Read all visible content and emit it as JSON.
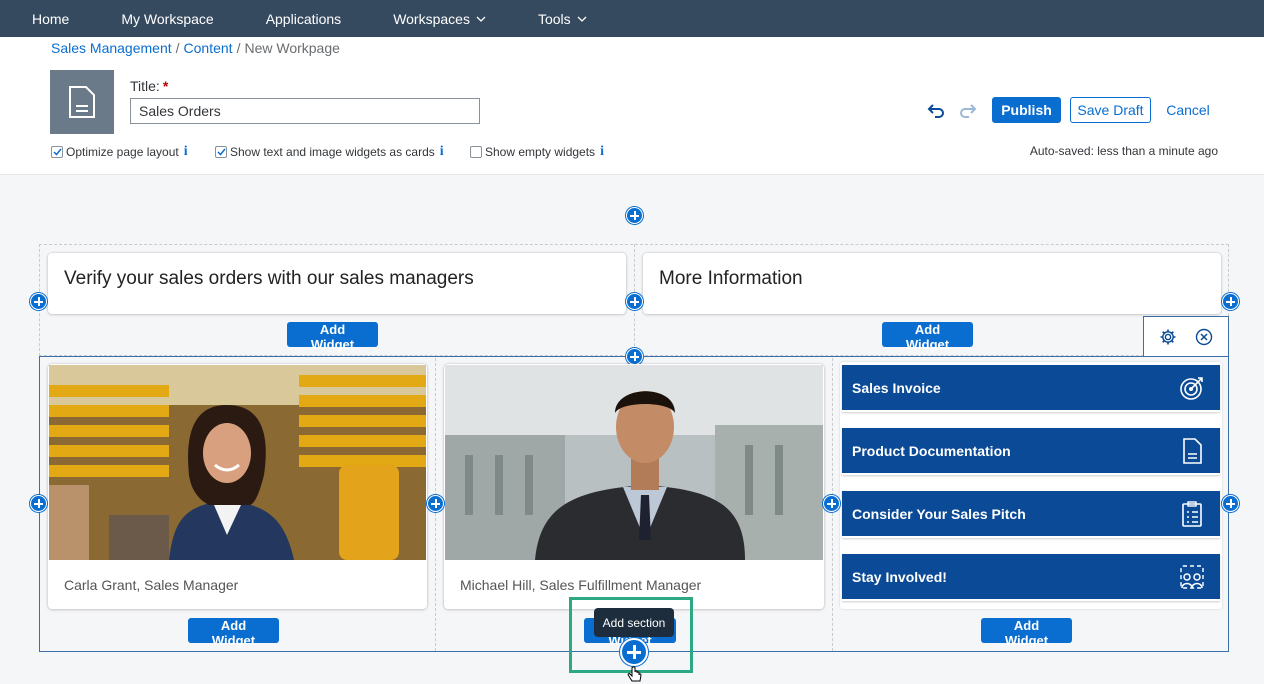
{
  "topnav": {
    "items": [
      {
        "label": "Home"
      },
      {
        "label": "My Workspace"
      },
      {
        "label": "Applications"
      },
      {
        "label": "Workspaces"
      },
      {
        "label": "Tools"
      }
    ]
  },
  "breadcrumb": {
    "items": [
      "Sales Management",
      "Content"
    ],
    "current": "New Workpage"
  },
  "header": {
    "page_icon": "document-icon",
    "title_label": "Title:",
    "required_marker": "*",
    "title_value": "Sales Orders",
    "publish_label": "Publish",
    "save_draft_label": "Save Draft",
    "cancel_label": "Cancel",
    "autosave_text": "Auto-saved: less than a minute ago"
  },
  "options": [
    {
      "label": "Optimize page layout",
      "checked": true
    },
    {
      "label": "Show text and image widgets as cards",
      "checked": true
    },
    {
      "label": "Show empty widgets",
      "checked": false
    }
  ],
  "info_glyph": "i",
  "section1": {
    "left_text": "Verify your sales orders with our sales managers",
    "right_text": "More Information",
    "add_widget_label": "Add Widget"
  },
  "section2": {
    "person1": "Carla Grant, Sales Manager",
    "person2": "Michael Hill, Sales Fulfillment Manager",
    "links": [
      {
        "label": "Sales Invoice",
        "icon": "target-icon"
      },
      {
        "label": "Product Documentation",
        "icon": "document-icon"
      },
      {
        "label": "Consider Your Sales Pitch",
        "icon": "clipboard-icon"
      },
      {
        "label": "Stay Involved!",
        "icon": "people-icon"
      }
    ],
    "add_widget_label": "Add Widget"
  },
  "tooltip": "Add section",
  "colors": {
    "nav_bg": "#354a5f",
    "accent": "#0a6ed1",
    "tile_bg": "#0a4a96",
    "highlight": "#2ca884"
  }
}
